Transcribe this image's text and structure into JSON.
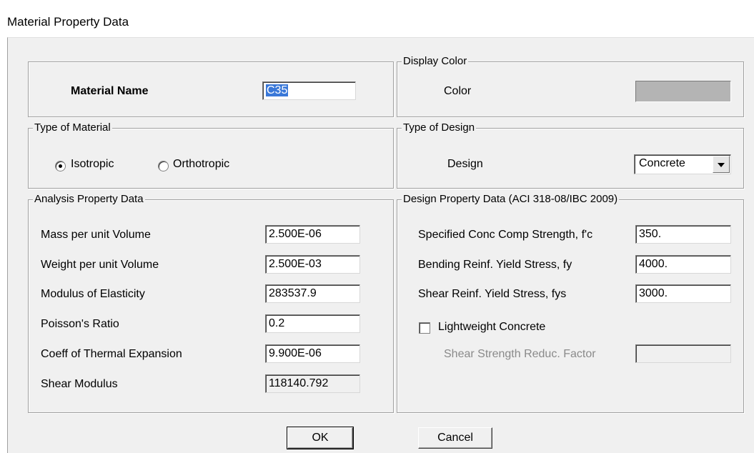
{
  "window": {
    "title": "Material Property Data"
  },
  "material_name": {
    "label": "Material Name",
    "value": "C35"
  },
  "display_color": {
    "legend": "Display Color",
    "label": "Color",
    "swatch_color": "#b4b4b4"
  },
  "type_of_material": {
    "legend": "Type of Material",
    "options": [
      {
        "label": "Isotropic",
        "selected": true
      },
      {
        "label": "Orthotropic",
        "selected": false
      }
    ]
  },
  "type_of_design": {
    "legend": "Type of Design",
    "label": "Design",
    "value": "Concrete"
  },
  "analysis": {
    "legend": "Analysis Property Data",
    "rows": [
      {
        "label": "Mass per unit Volume",
        "value": "2.500E-06"
      },
      {
        "label": "Weight per unit Volume",
        "value": "2.500E-03"
      },
      {
        "label": "Modulus of Elasticity",
        "value": "283537.9"
      },
      {
        "label": "Poisson's Ratio",
        "value": "0.2"
      },
      {
        "label": "Coeff of Thermal Expansion",
        "value": "9.900E-06"
      },
      {
        "label": "Shear Modulus",
        "value": "118140.792"
      }
    ]
  },
  "design": {
    "legend": "Design Property Data (ACI 318-08/IBC 2009)",
    "rows": [
      {
        "label": "Specified Conc Comp Strength, f'c",
        "value": "350."
      },
      {
        "label": "Bending Reinf. Yield Stress, fy",
        "value": "4000."
      },
      {
        "label": "Shear Reinf. Yield Stress, fys",
        "value": "3000."
      }
    ],
    "lightweight_label": "Lightweight Concrete",
    "lightweight_checked": false,
    "reduc_label": "Shear Strength Reduc. Factor",
    "reduc_value": ""
  },
  "buttons": {
    "ok": "OK",
    "cancel": "Cancel"
  }
}
